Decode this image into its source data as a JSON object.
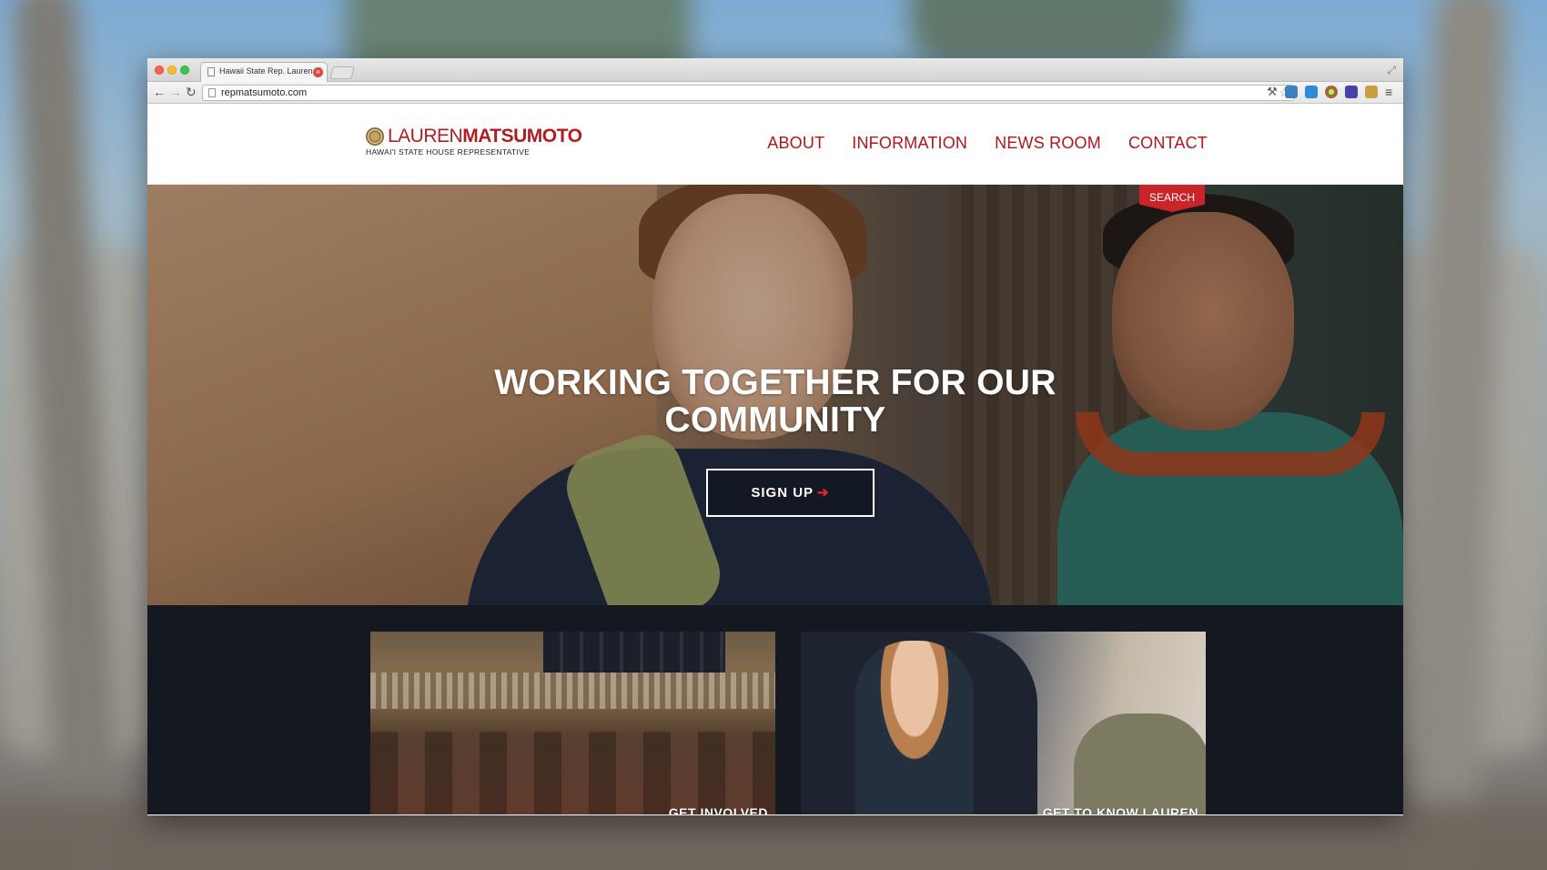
{
  "browser": {
    "tab_title": "Hawaii State Rep. Lauren M",
    "tab_close": "×",
    "url": "repmatsumoto.com",
    "fullscreen": "⤢",
    "nav": {
      "back": "←",
      "forward": "→",
      "reload": "↻"
    },
    "star": "☆",
    "menu": "≡",
    "extensions": [
      "wrench-icon",
      "extension-1-icon",
      "extension-2-icon",
      "chrome-icon",
      "extension-4-icon",
      "extension-5-icon"
    ]
  },
  "site": {
    "logo": {
      "first_name": "LAUREN",
      "last_name": "MATSUMOTO",
      "tagline": "HAWAI'I STATE HOUSE REPRESENTATIVE"
    },
    "nav": [
      "ABOUT",
      "INFORMATION",
      "NEWS ROOM",
      "CONTACT"
    ],
    "search_label": "SEARCH",
    "hero": {
      "title_line1": "WORKING TOGETHER FOR OUR",
      "title_line2": "COMMUNITY",
      "cta_label": "SIGN UP",
      "cta_arrow": "➔"
    },
    "cards": [
      {
        "label": "GET INVOLVED"
      },
      {
        "label": "GET TO KNOW LAUREN"
      }
    ]
  },
  "colors": {
    "brand_red": "#b3141b",
    "search_red": "#c8242a",
    "dark_section": "#141821"
  }
}
